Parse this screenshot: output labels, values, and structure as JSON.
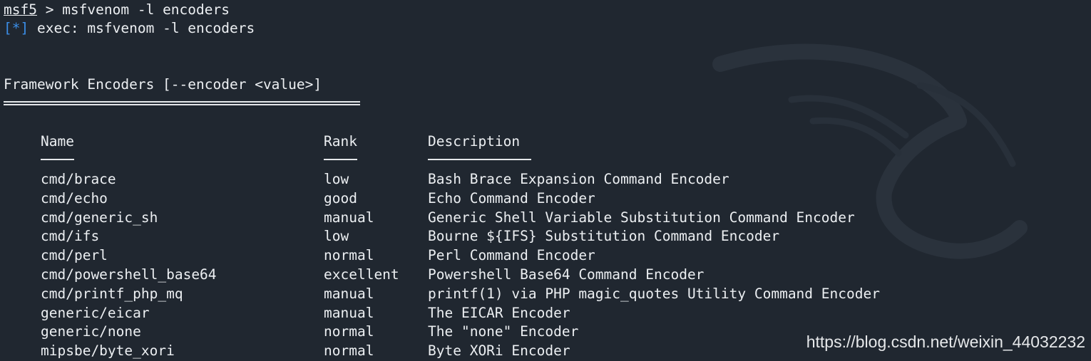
{
  "terminal": {
    "prompt_name": "msf5",
    "prompt_rest": " > msfvenom -l encoders",
    "info_tag": "[*]",
    "info_rest": " exec: msfvenom -l encoders",
    "section_title": "Framework Encoders [--encoder <value>]",
    "columns": {
      "name": "Name",
      "rank": "Rank",
      "description": "Description"
    },
    "rows": [
      {
        "name": "cmd/brace",
        "rank": "low",
        "description": "Bash Brace Expansion Command Encoder"
      },
      {
        "name": "cmd/echo",
        "rank": "good",
        "description": "Echo Command Encoder"
      },
      {
        "name": "cmd/generic_sh",
        "rank": "manual",
        "description": "Generic Shell Variable Substitution Command Encoder"
      },
      {
        "name": "cmd/ifs",
        "rank": "low",
        "description": "Bourne ${IFS} Substitution Command Encoder"
      },
      {
        "name": "cmd/perl",
        "rank": "normal",
        "description": "Perl Command Encoder"
      },
      {
        "name": "cmd/powershell_base64",
        "rank": "excellent",
        "description": "Powershell Base64 Command Encoder"
      },
      {
        "name": "cmd/printf_php_mq",
        "rank": "manual",
        "description": "printf(1) via PHP magic_quotes Utility Command Encoder"
      },
      {
        "name": "generic/eicar",
        "rank": "manual",
        "description": "The EICAR Encoder"
      },
      {
        "name": "generic/none",
        "rank": "normal",
        "description": "The \"none\" Encoder"
      },
      {
        "name": "mipsbe/byte_xori",
        "rank": "normal",
        "description": "Byte XORi Encoder"
      }
    ]
  },
  "watermark": "https://blog.csdn.net/weixin_44032232",
  "colors": {
    "background": "#202730",
    "text": "#eceff2",
    "info": "#3b8ee8"
  },
  "icons": {
    "background_logo": "kali-dragon-icon"
  }
}
